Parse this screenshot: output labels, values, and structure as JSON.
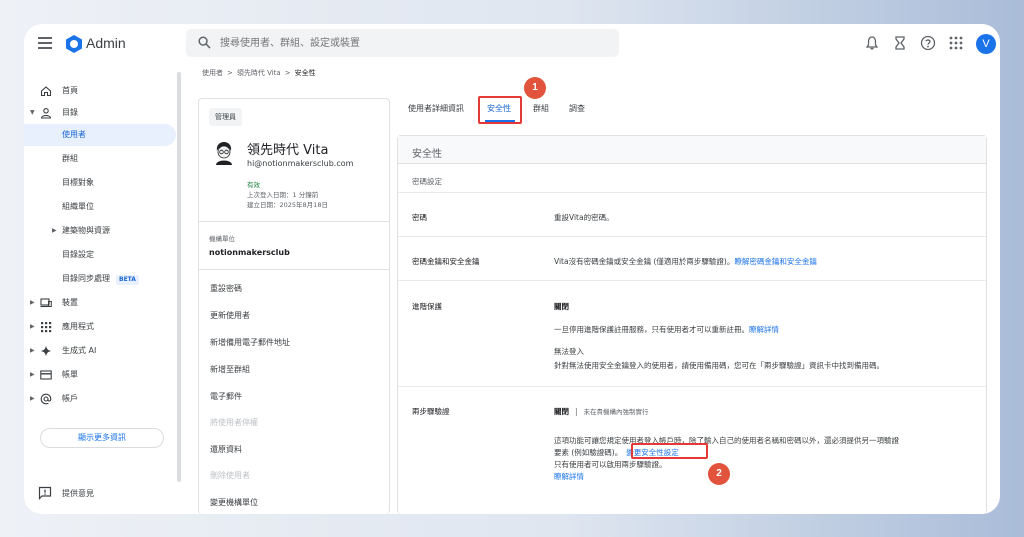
{
  "header": {
    "app_name": "Admin",
    "search_placeholder": "搜尋使用者、群組、設定或裝置",
    "avatar_letter": "V"
  },
  "sidebar": {
    "items": [
      {
        "label": "首頁"
      },
      {
        "label": "目錄"
      },
      {
        "label": "使用者"
      },
      {
        "label": "群組"
      },
      {
        "label": "目標對象"
      },
      {
        "label": "組織單位"
      },
      {
        "label": "建築物與資源"
      },
      {
        "label": "目錄設定"
      },
      {
        "label": "目錄同步處理"
      },
      {
        "label": "裝置"
      },
      {
        "label": "應用程式"
      },
      {
        "label": "生成式 AI"
      },
      {
        "label": "帳單"
      },
      {
        "label": "帳戶"
      }
    ],
    "beta_badge": "BETA",
    "show_more": "顯示更多資訊",
    "feedback": "提供意見"
  },
  "breadcrumb": {
    "items": [
      "使用者",
      "領先時代 Vita",
      "安全性"
    ],
    "separator": ">"
  },
  "user_card": {
    "role": "管理員",
    "name": "領先時代 Vita",
    "email": "hi@notionmakersclub.com",
    "status": "有效",
    "last_login": "上次登入日期：1 分鐘前",
    "created": "建立日期：2025年8月18日",
    "org_unit_label": "機構單位",
    "org_unit_value": "notionmakersclub",
    "actions": [
      {
        "label": "重設密碼",
        "enabled": true
      },
      {
        "label": "更新使用者",
        "enabled": true
      },
      {
        "label": "新增備用電子郵件地址",
        "enabled": true
      },
      {
        "label": "新增至群組",
        "enabled": true
      },
      {
        "label": "電子郵件",
        "enabled": true
      },
      {
        "label": "將使用者停權",
        "enabled": false
      },
      {
        "label": "還原資料",
        "enabled": true
      },
      {
        "label": "刪除使用者",
        "enabled": false
      },
      {
        "label": "變更機構單位",
        "enabled": true
      }
    ]
  },
  "tabs": [
    {
      "label": "使用者詳細資訊"
    },
    {
      "label": "安全性"
    },
    {
      "label": "群組"
    },
    {
      "label": "調查"
    }
  ],
  "security": {
    "title": "安全性",
    "section": "密碼設定",
    "password_label": "密碼",
    "password_text": "重設Vita的密碼。",
    "keys_label": "密碼金鑰和安全金鑰",
    "keys_text": "Vita沒有密碼金鑰或安全金鑰 (僅適用於兩步驟驗證)。",
    "keys_link": "瞭解密碼金鑰和安全金鑰",
    "adv_label": "進階保護",
    "adv_status": "關閉",
    "adv_desc": "一旦停用進階保護註冊服務，只有使用者才可以重新註冊。",
    "adv_link": "瞭解詳情",
    "adv_cannot": "無法登入",
    "adv_cannot_desc": "針對無法使用安全金鑰登入的使用者，請使用備用碼，您可在「兩步驟驗證」資訊卡中找到備用碼。",
    "twostep_label": "兩步驟驗證",
    "twostep_status": "關閉",
    "twostep_sep": "|",
    "twostep_note": "未在貴機構內強制實行",
    "twostep_desc1": "這項功能可讓您規定使用者登入帳戶時，除了輸入自己的使用者名稱和密碼以外，還必須提供另一項驗證",
    "twostep_desc2": "要素 (例如驗證碼)。",
    "twostep_link": "變更安全性設定",
    "twostep_only": "只有使用者可以啟用兩步驟驗證。",
    "twostep_learn": "瞭解詳情"
  },
  "annotations": [
    "1",
    "2"
  ],
  "colors": {
    "accent": "#1a73e8",
    "highlight": "#e53935",
    "badge": "#e1533c"
  }
}
